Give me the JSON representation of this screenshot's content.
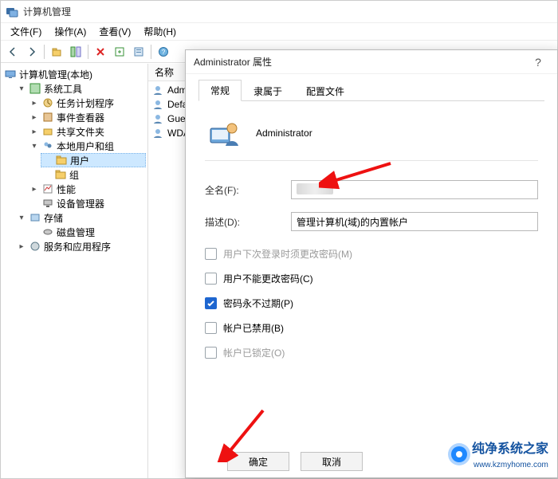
{
  "window": {
    "title": "计算机管理"
  },
  "menubar": [
    "文件(F)",
    "操作(A)",
    "查看(V)",
    "帮助(H)"
  ],
  "toolbar_icons": [
    "back-icon",
    "forward-icon",
    "up-icon",
    "show-hide-tree-icon",
    "refresh-icon",
    "delete-icon",
    "export-icon",
    "properties-icon",
    "help-icon"
  ],
  "tree": {
    "root": "计算机管理(本地)",
    "nodes": [
      {
        "label": "系统工具",
        "expanded": true,
        "children": [
          {
            "label": "任务计划程序"
          },
          {
            "label": "事件查看器"
          },
          {
            "label": "共享文件夹"
          },
          {
            "label": "本地用户和组",
            "expanded": true,
            "children": [
              {
                "label": "用户",
                "selected": true
              },
              {
                "label": "组"
              }
            ]
          },
          {
            "label": "性能"
          },
          {
            "label": "设备管理器"
          }
        ]
      },
      {
        "label": "存储",
        "expanded": true,
        "children": [
          {
            "label": "磁盘管理"
          }
        ]
      },
      {
        "label": "服务和应用程序",
        "expanded": false
      }
    ]
  },
  "list": {
    "header": "名称",
    "items": [
      "Administrator",
      "DefaultAccount",
      "Guest",
      "WDAGUtilityAccount"
    ],
    "items_display": [
      "Admini",
      "Defau",
      "Gues",
      "WDA"
    ]
  },
  "dialog": {
    "title": "Administrator 属性",
    "tabs": [
      "常规",
      "隶属于",
      "配置文件"
    ],
    "active_tab": 0,
    "user_name": "Administrator",
    "fields": {
      "fullname_label": "全名(F):",
      "fullname_value": "",
      "desc_label": "描述(D):",
      "desc_value": "管理计算机(域)的内置帐户"
    },
    "checks": [
      {
        "label": "用户下次登录时须更改密码(M)",
        "checked": false,
        "disabled": true
      },
      {
        "label": "用户不能更改密码(C)",
        "checked": false,
        "disabled": false
      },
      {
        "label": "密码永不过期(P)",
        "checked": true,
        "disabled": false
      },
      {
        "label": "帐户已禁用(B)",
        "checked": false,
        "disabled": false
      },
      {
        "label": "帐户已锁定(O)",
        "checked": false,
        "disabled": true
      }
    ],
    "buttons": {
      "ok": "确定",
      "cancel": "取消"
    }
  },
  "watermark": {
    "text": "纯净系统之家",
    "url": "www.kzmyhome.com"
  }
}
